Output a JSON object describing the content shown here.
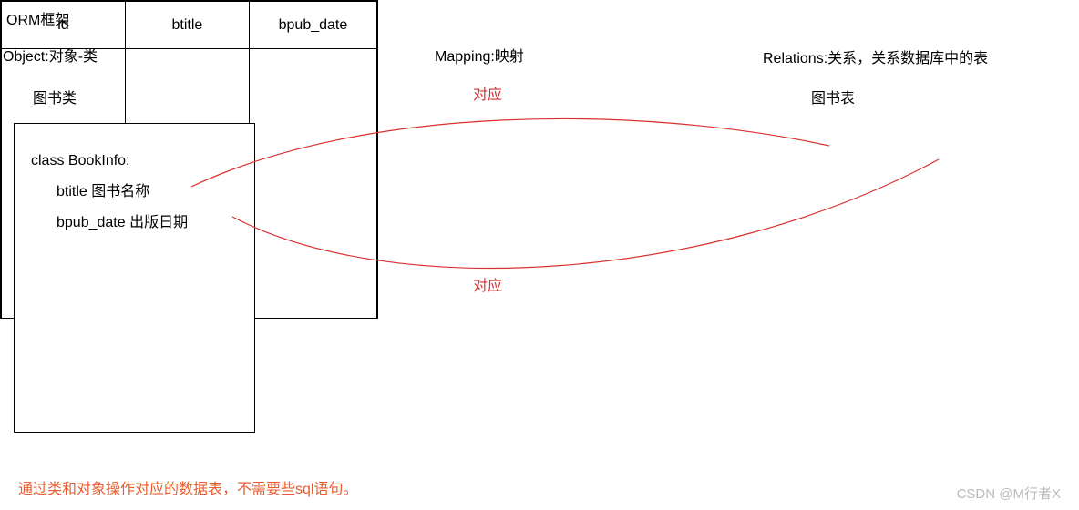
{
  "header": {
    "title": "ORM框架",
    "object_label": "Object:对象-类",
    "mapping_label": "Mapping:映射",
    "relations_label": "Relations:关系，关系数据库中的表"
  },
  "class_panel": {
    "title": "图书类",
    "class_name": "class BookInfo:",
    "field1": "btitle 图书名称",
    "field2": "bpub_date 出版日期"
  },
  "table_panel": {
    "title": "图书表",
    "columns": {
      "c0": "id",
      "c1": "btitle",
      "c2": "bpub_date"
    }
  },
  "arrows": {
    "top_label": "对应",
    "bottom_label": "对应"
  },
  "footer": {
    "note": "通过类和对象操作对应的数据表，不需要些sql语句。"
  },
  "watermark": "CSDN @M行者X"
}
